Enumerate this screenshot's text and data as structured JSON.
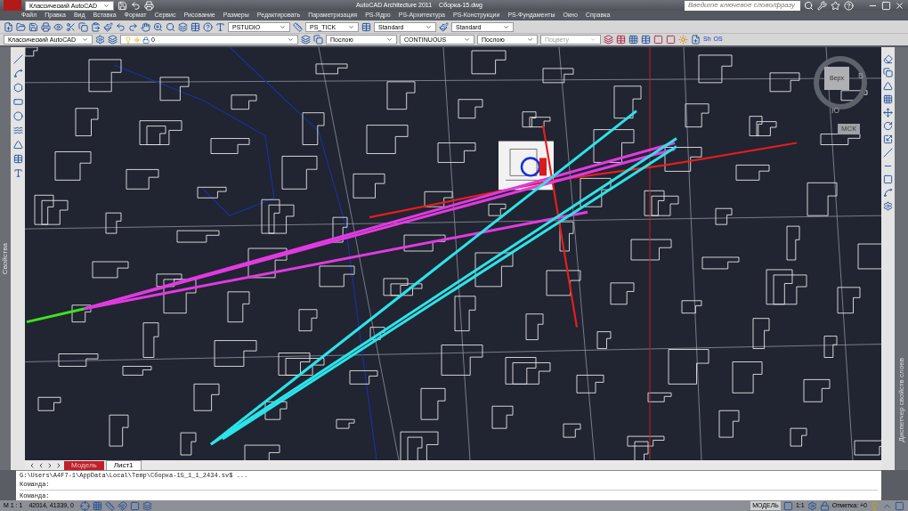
{
  "title_bar": {
    "workspace": "Классический AutoCAD",
    "app_title": "AutoCAD Architecture 2011",
    "file_name": "Сборка-15.dwg",
    "search": {
      "placeholder": "Введите ключевое слово/фразу"
    }
  },
  "menu": [
    "Файл",
    "Правка",
    "Вид",
    "Вставка",
    "Формат",
    "Сервис",
    "Рисование",
    "Размеры",
    "Редактировать",
    "Параметризация",
    "PS-Ядро",
    "PS-Архитектура",
    "PS-Конструкции",
    "PS-Фундаменты",
    "Окно",
    "Справка"
  ],
  "toolbar": {
    "text_style": "PSTUDIO",
    "dim_style": "PS_TICK",
    "table_style": "Standard",
    "multileader_style": "Standard"
  },
  "properties_bar": {
    "workspace": "Классический AutoCAD",
    "layer": "0",
    "color_setting": "Послою",
    "linetype": "CONTINUOUS",
    "lineweight": "Послою",
    "plot_style": {
      "value": "Поцвету",
      "disabled": true
    },
    "buttons": [
      "Sh",
      "OS"
    ]
  },
  "palettes": {
    "left": "Свойства",
    "right": "Диспетчер свойств слоев"
  },
  "viewcube": {
    "face": "Верх",
    "east": "В",
    "south": "Ю",
    "ucs": "МСК"
  },
  "layout_tabs": [
    {
      "label": "Модель",
      "selected": true
    },
    {
      "label": "Лист1",
      "selected": false
    }
  ],
  "command_history": [
    "G:\\Users\\A4F7-1\\AppData\\Local\\Temp\\Сборка-15_1_1_2434.sv$ ...",
    "Команда:"
  ],
  "command_prompt": "Команда:",
  "status_bar": {
    "scale": "М 1 : 1",
    "coordinates": "42014, 41339, 0",
    "space": "МОДЕЛЬ",
    "annotation_scale": "1:1",
    "elevation": "Отметка: +0"
  }
}
